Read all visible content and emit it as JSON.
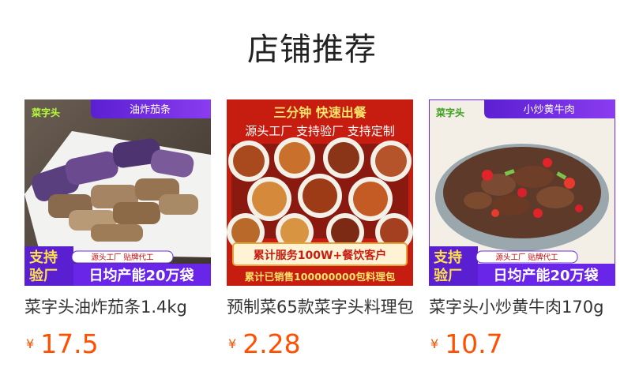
{
  "section": {
    "title": "店铺推荐"
  },
  "products": [
    {
      "name": "菜字头油炸茄条1.4kg",
      "currency": "¥",
      "price": "17.5",
      "image": {
        "brand": "菜字头",
        "tag": "油炸茄条",
        "badge_line1": "支持",
        "badge_line2": "验厂",
        "small_banner": "源头工厂 贴牌代工",
        "big_banner": "日均产能20万袋"
      }
    },
    {
      "name": "预制菜65款菜字头料理包",
      "currency": "¥",
      "price": "2.28",
      "image": {
        "headline": "三分钟 快速出餐",
        "subline": "源头工厂 支持验厂 支持定制",
        "served": "累计服务100W+餐饮客户",
        "sold": "累计已销售100000000包料理包"
      }
    },
    {
      "name": "菜字头小炒黄牛肉170g",
      "currency": "¥",
      "price": "10.7",
      "image": {
        "brand": "菜字头",
        "tag": "小炒黄牛肉",
        "badge_line1": "支持",
        "badge_line2": "验厂",
        "small_banner": "源头工厂 贴牌代工",
        "big_banner": "日均产能20万袋"
      }
    }
  ]
}
